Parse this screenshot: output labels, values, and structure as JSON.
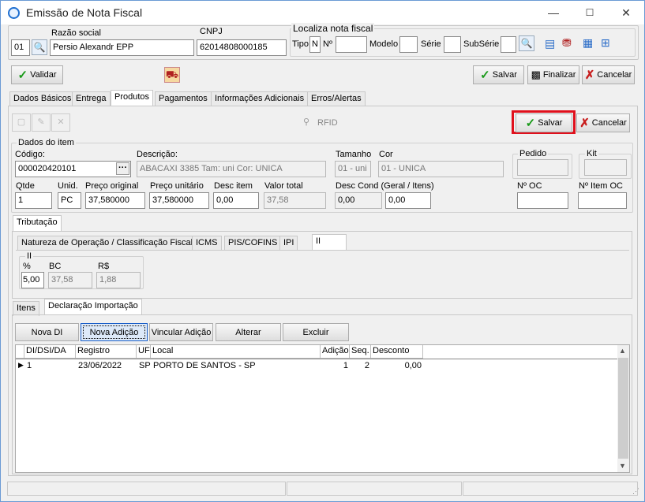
{
  "window": {
    "title": "Emissão de Nota Fiscal",
    "minimize": "—",
    "maximize": "☐",
    "close": "✕"
  },
  "header": {
    "razao_label": "Razão social",
    "empresa_code": "01",
    "razao_value": "Persio Alexandr EPP",
    "cnpj_label": "CNPJ",
    "cnpj_value": "62014808000185",
    "localiza_label": "Localiza nota fiscal",
    "tipo_label": "Tipo",
    "tipo_value": "N",
    "numero_label": "Nº",
    "modelo_label": "Modelo",
    "serie_label": "Série",
    "subserie_label": "SubSérie"
  },
  "toolbar": {
    "validar": "Validar",
    "salvar": "Salvar",
    "finalizar": "Finalizar",
    "cancelar": "Cancelar"
  },
  "tabs": [
    "Dados Básicos",
    "Entrega",
    "Produtos",
    "Pagamentos",
    "Informações Adicionais",
    "Erros/Alertas"
  ],
  "produtos": {
    "rfid": "RFID",
    "salvar": "Salvar",
    "cancelar": "Cancelar",
    "dados_item": "Dados do item",
    "codigo_label": "Código:",
    "codigo_value": "000020420101",
    "descricao_label": "Descrição:",
    "descricao_value": "ABACAXI 3385 Tam: uni Cor: UNICA",
    "tamanho_label": "Tamanho",
    "tamanho_value": "01 - uni",
    "cor_label": "Cor",
    "cor_value": "01 - UNICA",
    "pedido_label": "Pedido",
    "kit_label": "Kit",
    "qtde_label": "Qtde",
    "qtde_value": "1",
    "unid_label": "Unid.",
    "unid_value": "PC",
    "preco_original_label": "Preço original",
    "preco_original_value": "37,580000",
    "preco_unitario_label": "Preço unitário",
    "preco_unitario_value": "37,580000",
    "desc_item_label": "Desc item",
    "desc_item_value": "0,00",
    "valor_total_label": "Valor total",
    "valor_total_value": "37,58",
    "desc_cond_label": "Desc Cond (Geral / Itens)",
    "desc_cond_geral": "0,00",
    "desc_cond_itens": "0,00",
    "num_oc_label": "Nº OC",
    "num_item_oc_label": "Nº Item OC"
  },
  "tributacao": {
    "tab": "Tributação",
    "subtabs": [
      "Natureza de Operação / Classificação Fiscal",
      "ICMS",
      "PIS/COFINS",
      "IPI",
      "II"
    ],
    "group": "II",
    "pct_label": "%",
    "pct_value": "5,00",
    "bc_label": "BC",
    "bc_value": "37,58",
    "rs_label": "R$",
    "rs_value": "1,88"
  },
  "importacao": {
    "tabs": [
      "Itens",
      "Declaração Importação"
    ],
    "buttons": [
      "Nova DI",
      "Nova Adição",
      "Vincular Adição",
      "Alterar",
      "Excluir"
    ],
    "columns": [
      "DI/DSI/DA",
      "Registro",
      "UF",
      "Local",
      "Adição",
      "Seq.",
      "Desconto"
    ],
    "rows": [
      {
        "di": "1",
        "registro": "23/06/2022",
        "uf": "SP",
        "local": "PORTO DE SANTOS - SP",
        "adicao": "1",
        "seq": "2",
        "desconto": "0,00"
      }
    ]
  }
}
